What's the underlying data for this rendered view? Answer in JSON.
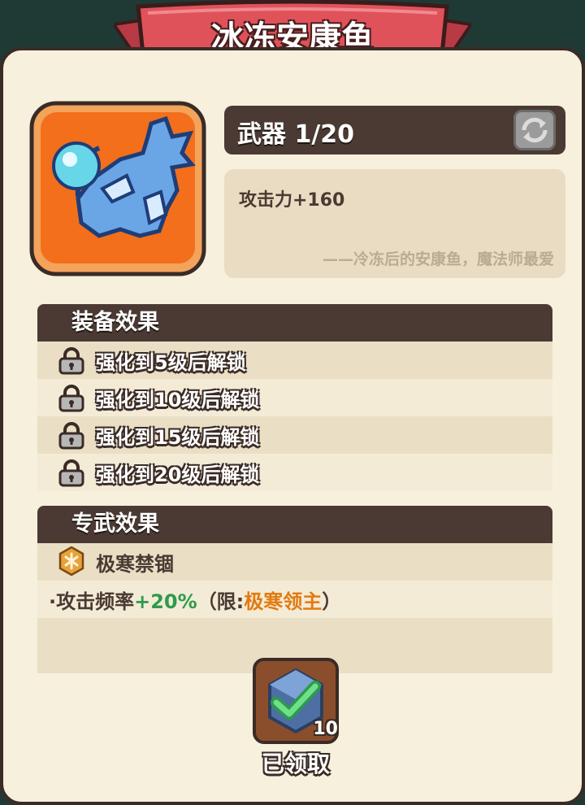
{
  "title": "冰冻安康鱼",
  "item": {
    "icon": "frozen-anglerfish-icon"
  },
  "weapon": {
    "label": "武器 1/20",
    "refresh_icon": "refresh-icon"
  },
  "description": {
    "stat": "攻击力+160",
    "quote": "——冷冻后的安康鱼，魔法师最爱"
  },
  "equip_effects": {
    "title": "装备效果",
    "items": [
      "强化到5级后解锁",
      "强化到10级后解锁",
      "强化到15级后解锁",
      "强化到20级后解锁"
    ]
  },
  "exclusive": {
    "title": "专武效果",
    "name": "极寒禁锢",
    "bonus": {
      "prefix": "·攻击频率",
      "value": "+20%",
      "mid": "（限:",
      "target": "极寒领主",
      "suffix": "）"
    }
  },
  "claim": {
    "count": "10",
    "label": "已领取",
    "icon": "check-gem-icon"
  },
  "colors": {
    "header": "#4a3a33",
    "panel": "#f6f0dc",
    "accent_green": "#2e9a4c",
    "accent_orange": "#e27a0f",
    "ribbon": "#e0525a"
  }
}
